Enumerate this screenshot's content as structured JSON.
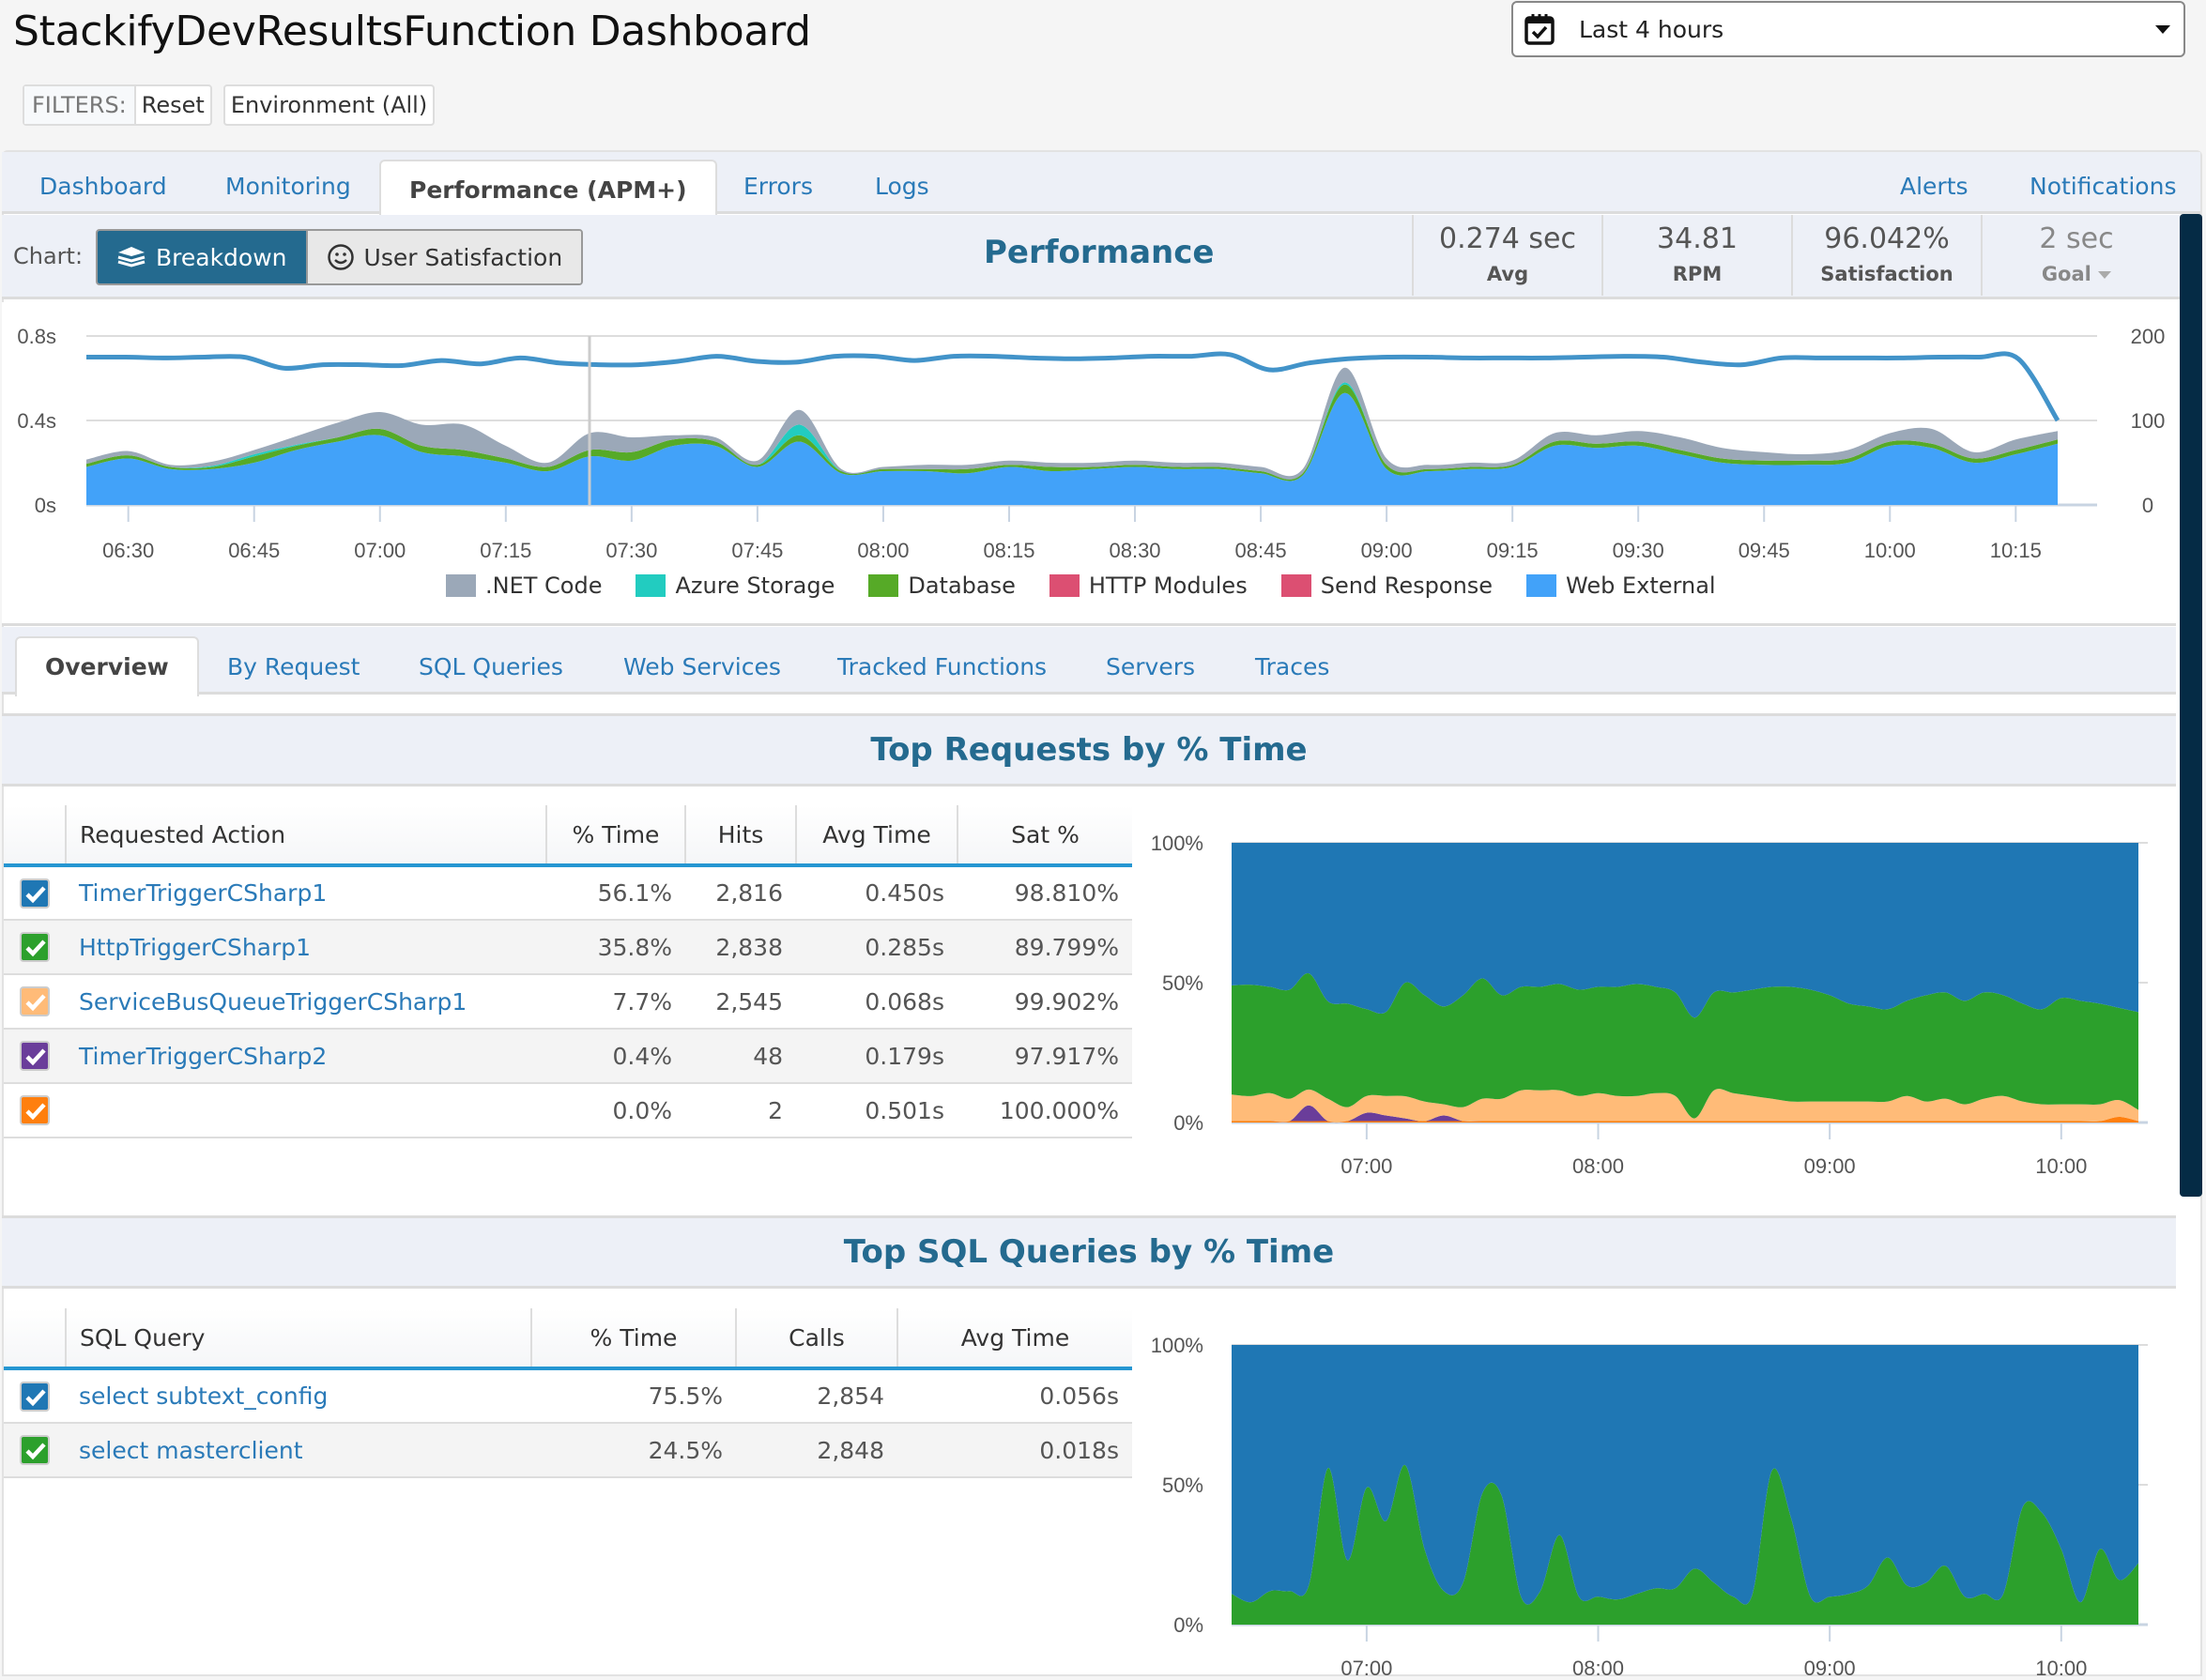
{
  "header": {
    "title": "StackifyDevResultsFunction Dashboard",
    "filters_label": "FILTERS:",
    "reset_label": "Reset",
    "environment_label": "Environment (All)",
    "date_range": "Last 4 hours"
  },
  "main_tabs": {
    "left": [
      {
        "label": "Dashboard",
        "active": false
      },
      {
        "label": "Monitoring",
        "active": false
      },
      {
        "label": "Performance (APM+)",
        "active": true
      },
      {
        "label": "Errors",
        "active": false
      },
      {
        "label": "Logs",
        "active": false
      }
    ],
    "right": [
      {
        "label": "Alerts"
      },
      {
        "label": "Notifications"
      }
    ]
  },
  "toolbar": {
    "chart_label": "Chart:",
    "breakdown_label": "Breakdown",
    "user_satisfaction_label": "User Satisfaction",
    "title": "Performance",
    "stats": [
      {
        "value": "0.274 sec",
        "label": "Avg"
      },
      {
        "value": "34.81",
        "label": "RPM"
      },
      {
        "value": "96.042%",
        "label": "Satisfaction"
      },
      {
        "value": "2 sec",
        "label": "Goal"
      }
    ]
  },
  "sub_tabs": [
    {
      "label": "Overview",
      "active": true
    },
    {
      "label": "By Request",
      "active": false
    },
    {
      "label": "SQL Queries",
      "active": false
    },
    {
      "label": "Web Services",
      "active": false
    },
    {
      "label": "Tracked Functions",
      "active": false
    },
    {
      "label": "Servers",
      "active": false
    },
    {
      "label": "Traces",
      "active": false
    }
  ],
  "top_requests": {
    "title": "Top Requests by % Time",
    "columns": [
      "Requested Action",
      "% Time",
      "Hits",
      "Avg Time",
      "Sat %"
    ],
    "rows": [
      {
        "name": "TimerTriggerCSharp1",
        "pct_time": "56.1%",
        "hits": "2,816",
        "avg_time": "0.450s",
        "sat": "98.810%",
        "color": "#1f77b4",
        "checked": true
      },
      {
        "name": "HttpTriggerCSharp1",
        "pct_time": "35.8%",
        "hits": "2,838",
        "avg_time": "0.285s",
        "sat": "89.799%",
        "color": "#2ca02c",
        "checked": true
      },
      {
        "name": "ServiceBusQueueTriggerCSharp1",
        "pct_time": "7.7%",
        "hits": "2,545",
        "avg_time": "0.068s",
        "sat": "99.902%",
        "color": "#ffbb78",
        "checked": true
      },
      {
        "name": "TimerTriggerCSharp2",
        "pct_time": "0.4%",
        "hits": "48",
        "avg_time": "0.179s",
        "sat": "97.917%",
        "color": "#6a3d9a",
        "checked": true
      },
      {
        "name": "",
        "pct_time": "0.0%",
        "hits": "2",
        "avg_time": "0.501s",
        "sat": "100.000%",
        "color": "#ff7f0e",
        "checked": true
      }
    ]
  },
  "top_sql": {
    "title": "Top SQL Queries by % Time",
    "columns": [
      "SQL Query",
      "% Time",
      "Calls",
      "Avg Time"
    ],
    "rows": [
      {
        "name": "select subtext_config",
        "pct_time": "75.5%",
        "calls": "2,854",
        "avg_time": "0.056s",
        "color": "#1f77b4",
        "checked": true
      },
      {
        "name": "select masterclient",
        "pct_time": "24.5%",
        "calls": "2,848",
        "avg_time": "0.018s",
        "color": "#2ca02c",
        "checked": true
      }
    ]
  },
  "chart_data": [
    {
      "id": "performance",
      "type": "area",
      "title": "Performance",
      "stacked": true,
      "xlabel": "",
      "ylabel": "",
      "x_ticks": [
        "06:30",
        "06:45",
        "07:00",
        "07:15",
        "07:30",
        "07:45",
        "08:00",
        "08:15",
        "08:30",
        "08:45",
        "09:00",
        "09:15",
        "09:30",
        "09:45",
        "10:00",
        "10:15"
      ],
      "y_ticks_left": [
        "0s",
        "0.4s",
        "0.8s"
      ],
      "y_ticks_right": [
        "0",
        "100",
        "200"
      ],
      "ylim_left": [
        0,
        0.8
      ],
      "ylim_right": [
        0,
        200
      ],
      "x_minutes_range": [
        0,
        235
      ],
      "x_start": "06:25",
      "x": [
        0,
        5,
        10,
        15,
        20,
        25,
        30,
        35,
        40,
        45,
        50,
        55,
        60,
        65,
        70,
        75,
        80,
        85,
        90,
        95,
        100,
        105,
        110,
        115,
        120,
        125,
        130,
        135,
        140,
        145,
        150,
        155,
        160,
        165,
        170,
        175,
        180,
        185,
        190,
        195,
        200,
        205,
        210,
        215,
        220,
        225,
        230,
        235
      ],
      "grid": true,
      "legend_position": "bottom",
      "series": [
        {
          "name": "Web External",
          "color": "#42a2f9",
          "values": [
            0.18,
            0.22,
            0.17,
            0.17,
            0.2,
            0.26,
            0.3,
            0.33,
            0.25,
            0.23,
            0.2,
            0.16,
            0.23,
            0.21,
            0.28,
            0.28,
            0.18,
            0.3,
            0.15,
            0.16,
            0.16,
            0.15,
            0.18,
            0.16,
            0.17,
            0.18,
            0.17,
            0.17,
            0.15,
            0.14,
            0.53,
            0.17,
            0.16,
            0.17,
            0.18,
            0.28,
            0.27,
            0.28,
            0.24,
            0.2,
            0.19,
            0.19,
            0.2,
            0.28,
            0.27,
            0.2,
            0.24,
            0.29
          ]
        },
        {
          "name": "Database",
          "color": "#56aa27",
          "values": [
            0.015,
            0.015,
            0.01,
            0.01,
            0.03,
            0.02,
            0.02,
            0.03,
            0.03,
            0.03,
            0.02,
            0.02,
            0.03,
            0.04,
            0.03,
            0.02,
            0.01,
            0.03,
            0.01,
            0.01,
            0.01,
            0.02,
            0.01,
            0.02,
            0.01,
            0.01,
            0.01,
            0.01,
            0.01,
            0.01,
            0.04,
            0.02,
            0.01,
            0.01,
            0.01,
            0.02,
            0.02,
            0.02,
            0.02,
            0.02,
            0.02,
            0.02,
            0.02,
            0.02,
            0.02,
            0.02,
            0.02,
            0.02
          ]
        },
        {
          "name": "HTTP Modules",
          "color": "#dc4f72",
          "values": [
            0,
            0,
            0,
            0,
            0,
            0,
            0,
            0,
            0,
            0,
            0,
            0,
            0,
            0,
            0,
            0,
            0,
            0,
            0,
            0,
            0,
            0,
            0,
            0,
            0,
            0,
            0,
            0,
            0,
            0,
            0,
            0,
            0,
            0,
            0,
            0,
            0,
            0,
            0,
            0,
            0,
            0,
            0,
            0,
            0,
            0,
            0,
            0
          ]
        },
        {
          "name": "Send Response",
          "color": "#dc4f72",
          "values": [
            0,
            0,
            0,
            0,
            0,
            0,
            0,
            0,
            0,
            0,
            0,
            0,
            0,
            0,
            0,
            0,
            0,
            0,
            0,
            0,
            0,
            0,
            0,
            0,
            0,
            0,
            0,
            0,
            0,
            0,
            0,
            0,
            0,
            0,
            0,
            0,
            0,
            0,
            0,
            0,
            0,
            0,
            0,
            0,
            0,
            0,
            0,
            0
          ]
        },
        {
          "name": "Azure Storage",
          "color": "#22ccc0",
          "values": [
            0,
            0,
            0,
            0.005,
            0.01,
            0.005,
            0,
            0,
            0,
            0,
            0,
            0,
            0,
            0,
            0,
            0,
            0,
            0.05,
            0,
            0,
            0,
            0,
            0,
            0,
            0,
            0,
            0,
            0,
            0,
            0,
            0.01,
            0,
            0,
            0,
            0,
            0,
            0,
            0,
            0,
            0,
            0,
            0,
            0,
            0,
            0,
            0,
            0,
            0
          ]
        },
        {
          "name": ".NET Code",
          "color": "#9ba8b8",
          "values": [
            0.02,
            0.02,
            0.01,
            0.02,
            0.02,
            0.04,
            0.07,
            0.08,
            0.1,
            0.12,
            0.06,
            0.02,
            0.08,
            0.07,
            0.02,
            0.02,
            0.02,
            0.07,
            0.01,
            0.01,
            0.02,
            0.02,
            0.02,
            0.02,
            0.02,
            0.02,
            0.02,
            0.02,
            0.02,
            0.02,
            0.07,
            0.03,
            0.02,
            0.02,
            0.02,
            0.04,
            0.04,
            0.05,
            0.06,
            0.05,
            0.04,
            0.03,
            0.04,
            0.04,
            0.07,
            0.03,
            0.05,
            0.04
          ]
        }
      ],
      "rpm_series": {
        "name": "RPM",
        "color": "#4293c9",
        "values": [
          175,
          175,
          174,
          175,
          175,
          162,
          166,
          166,
          165,
          171,
          167,
          174,
          168,
          166,
          166,
          170,
          176,
          170,
          169,
          176,
          176,
          171,
          176,
          176,
          174,
          173,
          174,
          176,
          176,
          178,
          160,
          168,
          173,
          175,
          175,
          174,
          174,
          174,
          175,
          176,
          175,
          169,
          166,
          174,
          174,
          174,
          174,
          175,
          175,
          173,
          100
        ]
      }
    },
    {
      "id": "top-requests",
      "type": "area",
      "stacked_percent": true,
      "x_ticks": [
        "07:00",
        "08:00",
        "09:00",
        "10:00"
      ],
      "y_ticks": [
        "0%",
        "50%",
        "100%"
      ],
      "ylim": [
        0,
        100
      ],
      "x_minutes_range": [
        0,
        235
      ],
      "x_start": "06:25",
      "x": [
        0,
        5,
        10,
        15,
        20,
        25,
        30,
        35,
        40,
        45,
        50,
        55,
        60,
        65,
        70,
        75,
        80,
        85,
        90,
        95,
        100,
        105,
        110,
        115,
        120,
        125,
        130,
        135,
        140,
        145,
        150,
        155,
        160,
        165,
        170,
        175,
        180,
        185,
        190,
        195,
        200,
        205,
        210,
        215,
        220,
        225,
        230,
        235
      ],
      "series": [
        {
          "name": "",
          "color": "#ff7f0e",
          "values": [
            0.5,
            0.5,
            0.5,
            0.5,
            0.5,
            0.5,
            0.5,
            0.5,
            0.5,
            0.5,
            0.5,
            0.5,
            0.5,
            0.5,
            0.5,
            0.5,
            0.5,
            0.5,
            0.5,
            0.5,
            0.5,
            0.5,
            0.5,
            0.5,
            0.5,
            0.5,
            0.5,
            0.5,
            0.5,
            0.5,
            0.5,
            0.5,
            0.5,
            0.5,
            0.5,
            0.5,
            0.5,
            0.5,
            0.5,
            0.5,
            0.5,
            0.5,
            0.5,
            0.5,
            0.5,
            0.5,
            2,
            0.5
          ]
        },
        {
          "name": "TimerTriggerCSharp2",
          "color": "#6a3d9a",
          "values": [
            0,
            0,
            0,
            0,
            6,
            0,
            0,
            3,
            2,
            1,
            0,
            2,
            0,
            0,
            0,
            0,
            0,
            0,
            0,
            0,
            0,
            0,
            0,
            0,
            0,
            0,
            0,
            0,
            0,
            0,
            0,
            0,
            0,
            0,
            0,
            0,
            0,
            0,
            0,
            0,
            0,
            0,
            0,
            0,
            0,
            0,
            0,
            0
          ]
        },
        {
          "name": "ServiceBusQueueTriggerCSharp1",
          "color": "#ffbb78",
          "values": [
            9.5,
            9,
            10,
            8,
            6,
            8,
            5,
            6,
            7,
            8,
            7,
            4,
            5,
            8,
            8,
            11,
            11,
            11,
            9,
            10,
            9,
            9,
            10,
            9,
            1,
            11,
            10,
            9,
            8,
            7,
            7,
            7,
            7,
            7,
            7,
            9,
            7,
            8,
            6,
            8,
            9,
            7,
            6,
            6,
            6,
            6,
            6,
            4
          ]
        },
        {
          "name": "HttpTriggerCSharp1",
          "color": "#2ca02c",
          "values": [
            39,
            40,
            38,
            39,
            44,
            35,
            37,
            31,
            30,
            41,
            38,
            35,
            40,
            43,
            37,
            37,
            37,
            38,
            38,
            38,
            39,
            40,
            38,
            37,
            36,
            35,
            36,
            38,
            40,
            41,
            40,
            38,
            35,
            34,
            33,
            34,
            38,
            38,
            37,
            38,
            36,
            35,
            34,
            38,
            37,
            36,
            33,
            35
          ]
        },
        {
          "name": "TimerTriggerCSharp1",
          "color": "#1f77b4",
          "values": [
            51,
            51,
            51.5,
            52.5,
            49.5,
            57,
            57.5,
            59.5,
            60.5,
            50.5,
            54.5,
            58.5,
            54.5,
            48.5,
            54.5,
            51.5,
            51.5,
            50.5,
            52.5,
            51.5,
            51.5,
            50.5,
            51.5,
            53.5,
            62.5,
            53.5,
            53.5,
            52.5,
            51.5,
            51.5,
            52.5,
            54.5,
            57.5,
            58.5,
            59.5,
            56.5,
            54.5,
            53.5,
            56.5,
            53.5,
            54.5,
            57.5,
            59.5,
            55.5,
            56.5,
            57.5,
            59,
            60.5
          ]
        }
      ]
    },
    {
      "id": "top-sql",
      "type": "area",
      "stacked_percent": true,
      "x_ticks": [
        "07:00",
        "08:00",
        "09:00",
        "10:00"
      ],
      "y_ticks": [
        "0%",
        "50%",
        "100%"
      ],
      "ylim": [
        0,
        100
      ],
      "x_minutes_range": [
        0,
        235
      ],
      "x_start": "06:25",
      "x": [
        0,
        5,
        10,
        15,
        20,
        25,
        30,
        35,
        40,
        45,
        50,
        55,
        60,
        65,
        70,
        75,
        80,
        85,
        90,
        95,
        100,
        105,
        110,
        115,
        120,
        125,
        130,
        135,
        140,
        145,
        150,
        155,
        160,
        165,
        170,
        175,
        180,
        185,
        190,
        195,
        200,
        205,
        210,
        215,
        220,
        225,
        230,
        235
      ],
      "series": [
        {
          "name": "select masterclient",
          "color": "#2ca02c",
          "values": [
            11,
            8,
            12,
            12,
            14,
            56,
            23,
            49,
            37,
            57,
            27,
            12,
            15,
            47,
            46,
            10,
            12,
            32,
            10,
            10,
            9,
            11,
            13,
            13,
            20,
            15,
            10,
            11,
            55,
            38,
            10,
            10,
            11,
            14,
            24,
            14,
            15,
            21,
            10,
            11,
            11,
            42,
            40,
            27,
            8,
            27,
            16,
            22
          ]
        },
        {
          "name": "select subtext_config",
          "color": "#1f77b4",
          "values": [
            89,
            92,
            88,
            88,
            86,
            44,
            77,
            51,
            63,
            43,
            73,
            88,
            85,
            53,
            54,
            90,
            88,
            68,
            90,
            90,
            91,
            89,
            87,
            87,
            80,
            85,
            90,
            89,
            45,
            62,
            90,
            90,
            89,
            86,
            76,
            86,
            85,
            79,
            90,
            89,
            89,
            58,
            60,
            73,
            92,
            73,
            84,
            78
          ]
        }
      ]
    }
  ]
}
